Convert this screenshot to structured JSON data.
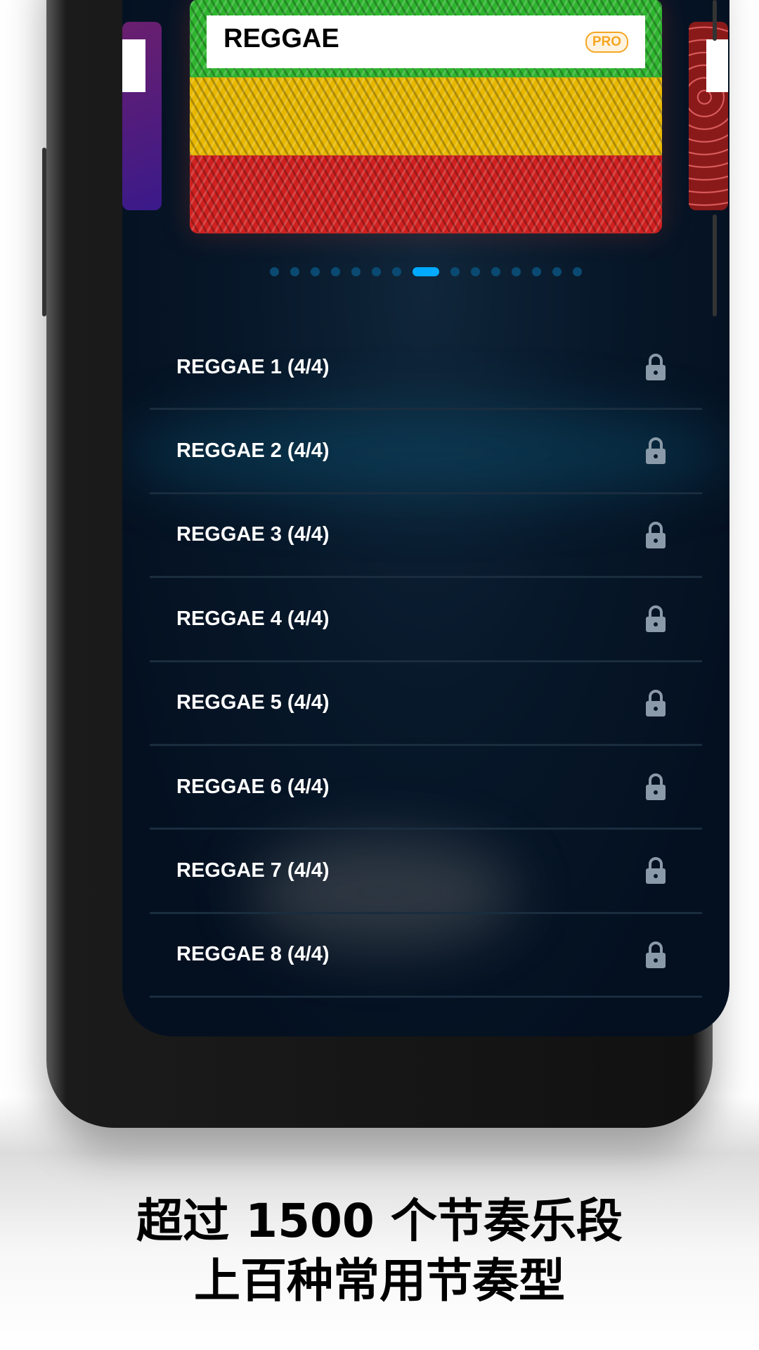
{
  "carousel": {
    "current_card": {
      "title": "REGGAE",
      "badge": "PRO"
    },
    "page_count": 15,
    "active_index": 7
  },
  "rhythms": [
    {
      "label": "REGGAE 1 (4/4)",
      "locked": true,
      "icon": "lock-icon"
    },
    {
      "label": "REGGAE 2 (4/4)",
      "locked": true,
      "icon": "lock-icon"
    },
    {
      "label": "REGGAE 3 (4/4)",
      "locked": true,
      "icon": "lock-icon"
    },
    {
      "label": "REGGAE 4 (4/4)",
      "locked": true,
      "icon": "lock-icon"
    },
    {
      "label": "REGGAE 5 (4/4)",
      "locked": true,
      "icon": "lock-icon"
    },
    {
      "label": "REGGAE 6 (4/4)",
      "locked": true,
      "icon": "lock-icon"
    },
    {
      "label": "REGGAE 7 (4/4)",
      "locked": true,
      "icon": "lock-icon"
    },
    {
      "label": "REGGAE 8 (4/4)",
      "locked": true,
      "icon": "lock-icon"
    }
  ],
  "caption": {
    "line1": "超过 1500 个节奏乐段",
    "line2": "上百种常用节奏型"
  },
  "colors": {
    "accent": "#00aaff",
    "pro": "#f5a623",
    "green": "#3cc83c",
    "yellow": "#f2c400",
    "red": "#d81e1e"
  }
}
